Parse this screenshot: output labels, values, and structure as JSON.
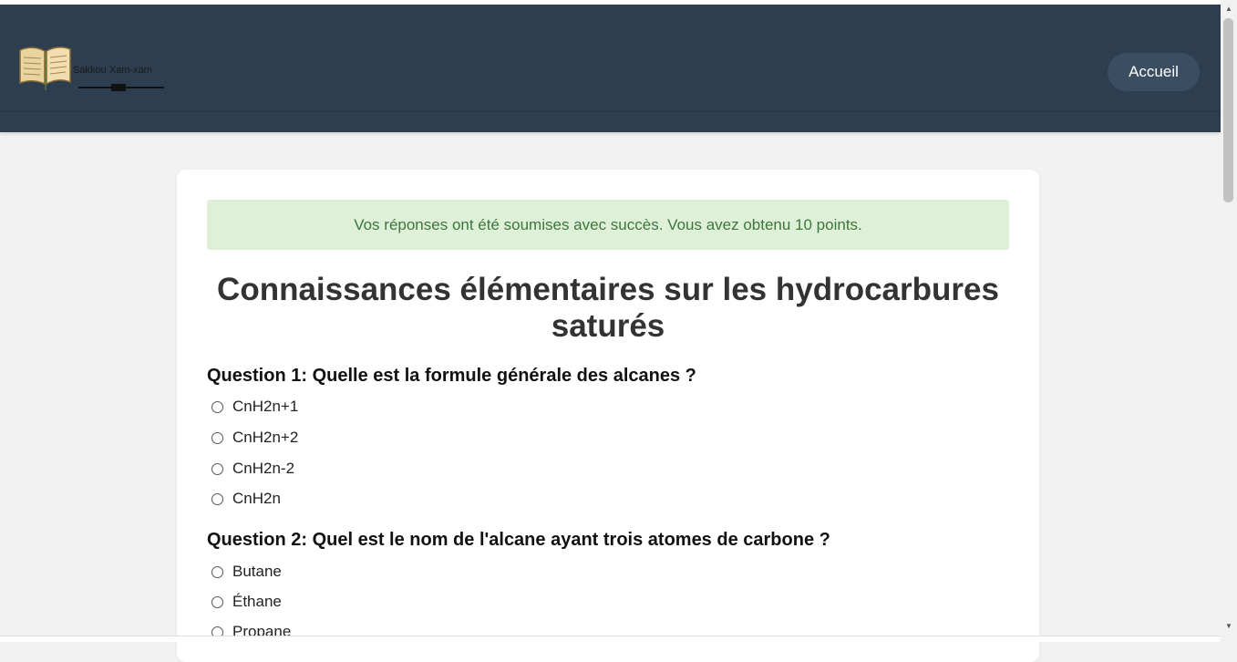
{
  "header": {
    "brand": "Sakkou Xam-xam",
    "nav_home": "Accueil"
  },
  "alert": {
    "message": "Vos réponses ont été soumises avec succès. Vous avez obtenu 10 points."
  },
  "quiz": {
    "title": "Connaissances élémentaires sur les hydrocarbures saturés",
    "questions": [
      {
        "text": "Question 1: Quelle est la formule générale des alcanes ?",
        "options": [
          "CnH2n+1",
          "CnH2n+2",
          "CnH2n-2",
          "CnH2n"
        ]
      },
      {
        "text": "Question 2: Quel est le nom de l'alcane ayant trois atomes de carbone ?",
        "options": [
          "Butane",
          "Éthane",
          "Propane"
        ]
      }
    ]
  },
  "colors": {
    "header_bg": "#2d3e50",
    "nav_button_bg": "#3b4d61",
    "alert_bg": "#dff0d8",
    "alert_text": "#3c763d",
    "page_bg": "#f2f2f2"
  },
  "icons": {
    "logo": "open-book-icon",
    "radio": "radio-button-icon"
  }
}
